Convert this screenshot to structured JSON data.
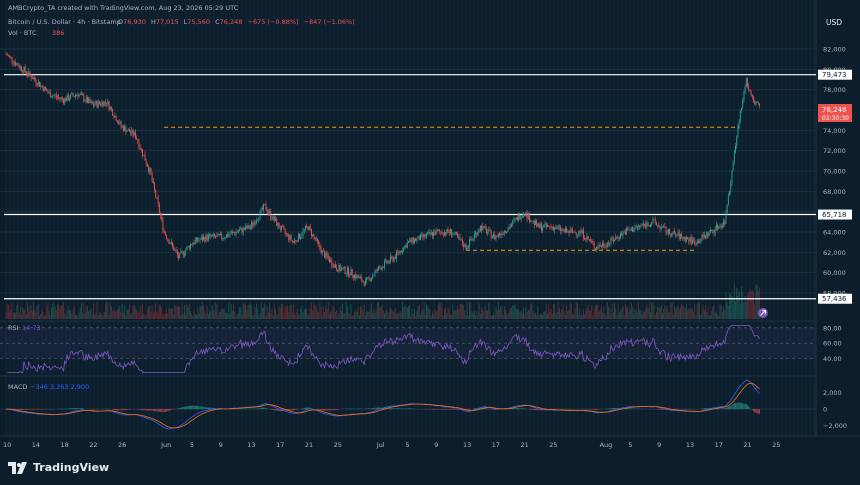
{
  "header": {
    "attribution": "AMBCrypto_TA created with TradingView.com, Aug 23, 2026 05:29 UTC",
    "symbol_line": "Bitcoin / U.S. Dollar · 4h · Bitstamp",
    "ohlc": {
      "open_label": "O",
      "open": "76,930",
      "high_label": "H",
      "high": "77,015",
      "low_label": "L",
      "low": "75,560",
      "close_label": "C",
      "close": "76,248",
      "change": "−675 (−0.88%)",
      "extra": "−847 (−1.06%)"
    },
    "volume_label": "Vol · BTC",
    "volume_value": "386"
  },
  "currency": "USD",
  "price_axis": [
    "82,000",
    "80,000",
    "78,000",
    "76,000",
    "74,000",
    "72,000",
    "70,000",
    "68,000",
    "66,000",
    "64,000",
    "62,000",
    "60,000",
    "58,000"
  ],
  "price_tags": {
    "resistance_top": "79,473",
    "current_price": "76,248",
    "countdown": "02:30:30",
    "resistance_mid": "65,718",
    "support_low": "57,436"
  },
  "rsi": {
    "label": "RSI",
    "values_text": "14  73",
    "levels": [
      "80.00",
      "60.00",
      "40.00"
    ]
  },
  "macd": {
    "label": "MACD",
    "values_text": "−346  3,263  2,900",
    "levels": [
      "2,000",
      "0",
      "−2,000"
    ]
  },
  "time_axis": [
    "10",
    "14",
    "18",
    "22",
    "26",
    "Jun",
    "5",
    "9",
    "13",
    "17",
    "21",
    "25",
    "Jul",
    "5",
    "9",
    "13",
    "17",
    "21",
    "25",
    "Aug",
    "5",
    "9",
    "13",
    "17",
    "21",
    "25"
  ],
  "brand": "TradingView",
  "colors": {
    "up": "#26a69a",
    "down": "#ef5350",
    "rsi": "#7e57c2",
    "macd": "#2962ff",
    "signal": "#ff6d00",
    "level_line": "#ffffff",
    "dashed": "#ff9800"
  },
  "chart_data": {
    "type": "candlestick",
    "title": "Bitcoin / U.S. Dollar · 4h · Bitstamp",
    "ylim": [
      57000,
      83000
    ],
    "horizontal_levels": [
      79473,
      65718,
      57436
    ],
    "dashed_levels": [
      {
        "value": 74300,
        "from": "Jun 1",
        "to": "Aug 20"
      },
      {
        "value": 62200,
        "from": "Jul 13",
        "to": "Aug 14"
      }
    ],
    "approx_closes": [
      {
        "x": "May 10",
        "y": 81500
      },
      {
        "x": "May 12",
        "y": 80200
      },
      {
        "x": "May 14",
        "y": 79000
      },
      {
        "x": "May 16",
        "y": 77600
      },
      {
        "x": "May 18",
        "y": 77000
      },
      {
        "x": "May 20",
        "y": 77600
      },
      {
        "x": "May 22",
        "y": 76500
      },
      {
        "x": "May 24",
        "y": 76800
      },
      {
        "x": "May 26",
        "y": 74400
      },
      {
        "x": "May 28",
        "y": 73500
      },
      {
        "x": "May 30",
        "y": 70000
      },
      {
        "x": "Jun 1",
        "y": 64000
      },
      {
        "x": "Jun 3",
        "y": 61500
      },
      {
        "x": "Jun 5",
        "y": 63000
      },
      {
        "x": "Jun 7",
        "y": 63500
      },
      {
        "x": "Jun 9",
        "y": 63500
      },
      {
        "x": "Jun 11",
        "y": 64000
      },
      {
        "x": "Jun 13",
        "y": 64500
      },
      {
        "x": "Jun 15",
        "y": 66500
      },
      {
        "x": "Jun 17",
        "y": 64500
      },
      {
        "x": "Jun 19",
        "y": 63000
      },
      {
        "x": "Jun 21",
        "y": 64500
      },
      {
        "x": "Jun 23",
        "y": 62000
      },
      {
        "x": "Jun 25",
        "y": 60500
      },
      {
        "x": "Jun 27",
        "y": 60000
      },
      {
        "x": "Jun 29",
        "y": 59000
      },
      {
        "x": "Jul 1",
        "y": 60500
      },
      {
        "x": "Jul 3",
        "y": 61500
      },
      {
        "x": "Jul 5",
        "y": 63000
      },
      {
        "x": "Jul 7",
        "y": 63500
      },
      {
        "x": "Jul 9",
        "y": 64000
      },
      {
        "x": "Jul 11",
        "y": 64000
      },
      {
        "x": "Jul 13",
        "y": 62500
      },
      {
        "x": "Jul 15",
        "y": 64500
      },
      {
        "x": "Jul 17",
        "y": 63500
      },
      {
        "x": "Jul 19",
        "y": 64500
      },
      {
        "x": "Jul 21",
        "y": 66000
      },
      {
        "x": "Jul 23",
        "y": 64500
      },
      {
        "x": "Jul 25",
        "y": 64500
      },
      {
        "x": "Jul 27",
        "y": 64000
      },
      {
        "x": "Jul 29",
        "y": 64000
      },
      {
        "x": "Jul 31",
        "y": 62500
      },
      {
        "x": "Aug 2",
        "y": 63000
      },
      {
        "x": "Aug 4",
        "y": 64000
      },
      {
        "x": "Aug 6",
        "y": 64500
      },
      {
        "x": "Aug 8",
        "y": 65000
      },
      {
        "x": "Aug 10",
        "y": 64000
      },
      {
        "x": "Aug 12",
        "y": 63500
      },
      {
        "x": "Aug 14",
        "y": 63000
      },
      {
        "x": "Aug 16",
        "y": 64000
      },
      {
        "x": "Aug 18",
        "y": 65000
      },
      {
        "x": "Aug 19",
        "y": 70000
      },
      {
        "x": "Aug 20",
        "y": 75000
      },
      {
        "x": "Aug 21",
        "y": 79000
      },
      {
        "x": "Aug 22",
        "y": 77000
      },
      {
        "x": "Aug 23",
        "y": 76248
      }
    ],
    "rsi_range": [
      20,
      85
    ],
    "macd_range": [
      -3000,
      3500
    ]
  }
}
